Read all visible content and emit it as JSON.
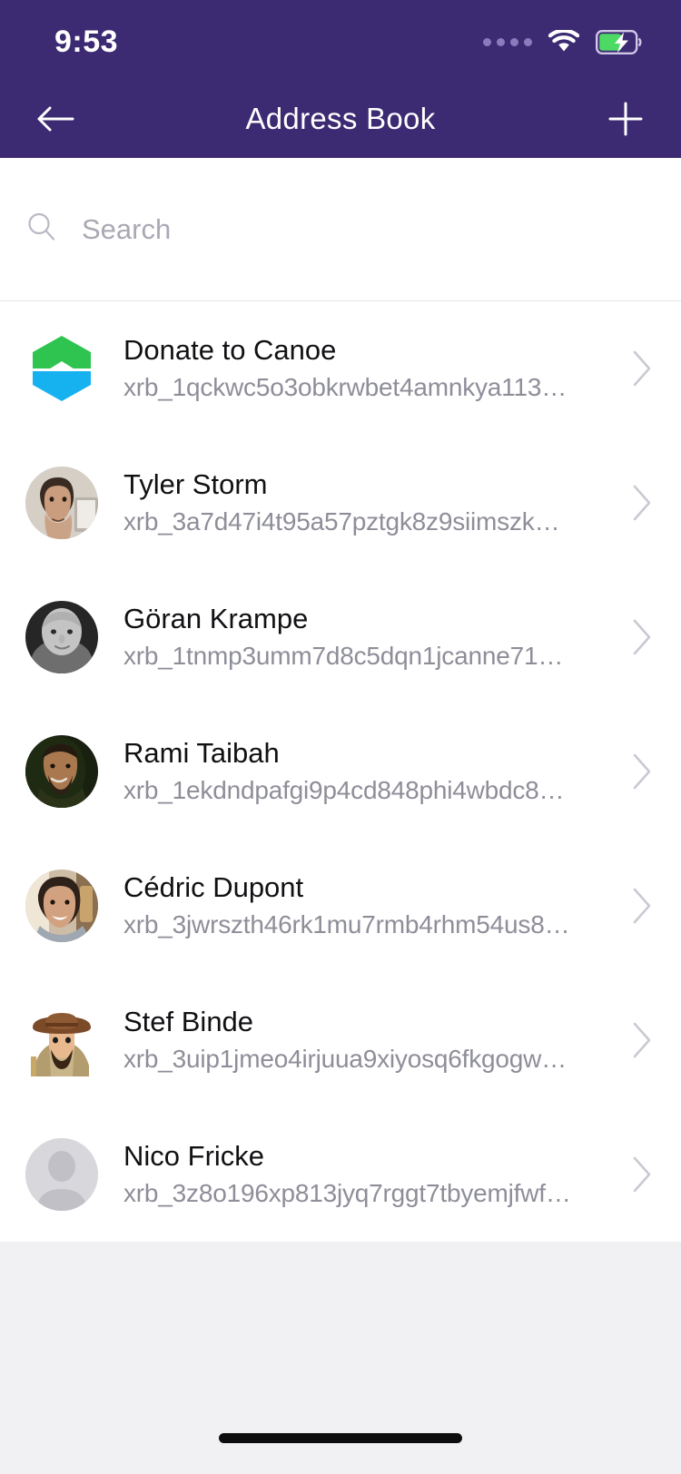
{
  "status_bar": {
    "time": "9:53",
    "signal_icon": "signal-dots-icon",
    "wifi_icon": "wifi-icon",
    "battery_icon": "battery-charging-icon",
    "battery_state": "charging"
  },
  "nav": {
    "back_icon": "arrow-left-icon",
    "title": "Address Book",
    "add_icon": "plus-icon"
  },
  "search": {
    "icon": "search-icon",
    "placeholder": "Search",
    "value": ""
  },
  "colors": {
    "header_purple": "#3c2a72",
    "page_background": "#f1f1f3",
    "card_background": "#ffffff",
    "name_text": "#111114",
    "address_text": "#8e8e99",
    "placeholder_text": "#a9a9b4",
    "logo_green": "#37c659",
    "logo_blue": "#16b2f0",
    "battery_green": "#4cd964"
  },
  "contacts": [
    {
      "name": "Donate to Canoe",
      "address": "xrb_1qckwc5o3obkrwbet4amnkya113…",
      "avatar_type": "canoe-logo",
      "chevron_icon": "chevron-right-icon"
    },
    {
      "name": "Tyler Storm",
      "address": "xrb_3a7d47i4t95a57pztgk8z9siimszk…",
      "avatar_type": "photo",
      "chevron_icon": "chevron-right-icon"
    },
    {
      "name": "Göran Krampe",
      "address": "xrb_1tnmp3umm7d8c5dqn1jcanne71…",
      "avatar_type": "photo",
      "chevron_icon": "chevron-right-icon"
    },
    {
      "name": "Rami Taibah",
      "address": "xrb_1ekdndpafgi9p4cd848phi4wbdc8…",
      "avatar_type": "photo",
      "chevron_icon": "chevron-right-icon"
    },
    {
      "name": "Cédric Dupont",
      "address": "xrb_3jwrszth46rk1mu7rmb4rhm54us8…",
      "avatar_type": "photo",
      "chevron_icon": "chevron-right-icon"
    },
    {
      "name": "Stef Binde",
      "address": "xrb_3uip1jmeo4irjuua9xiyosq6fkgogw…",
      "avatar_type": "illustration",
      "chevron_icon": "chevron-right-icon"
    },
    {
      "name": "Nico Fricke",
      "address": "xrb_3z8o196xp813jyq7rggt7tbyemjfwf…",
      "avatar_type": "placeholder",
      "chevron_icon": "chevron-right-icon"
    }
  ],
  "home_indicator": "home-indicator"
}
